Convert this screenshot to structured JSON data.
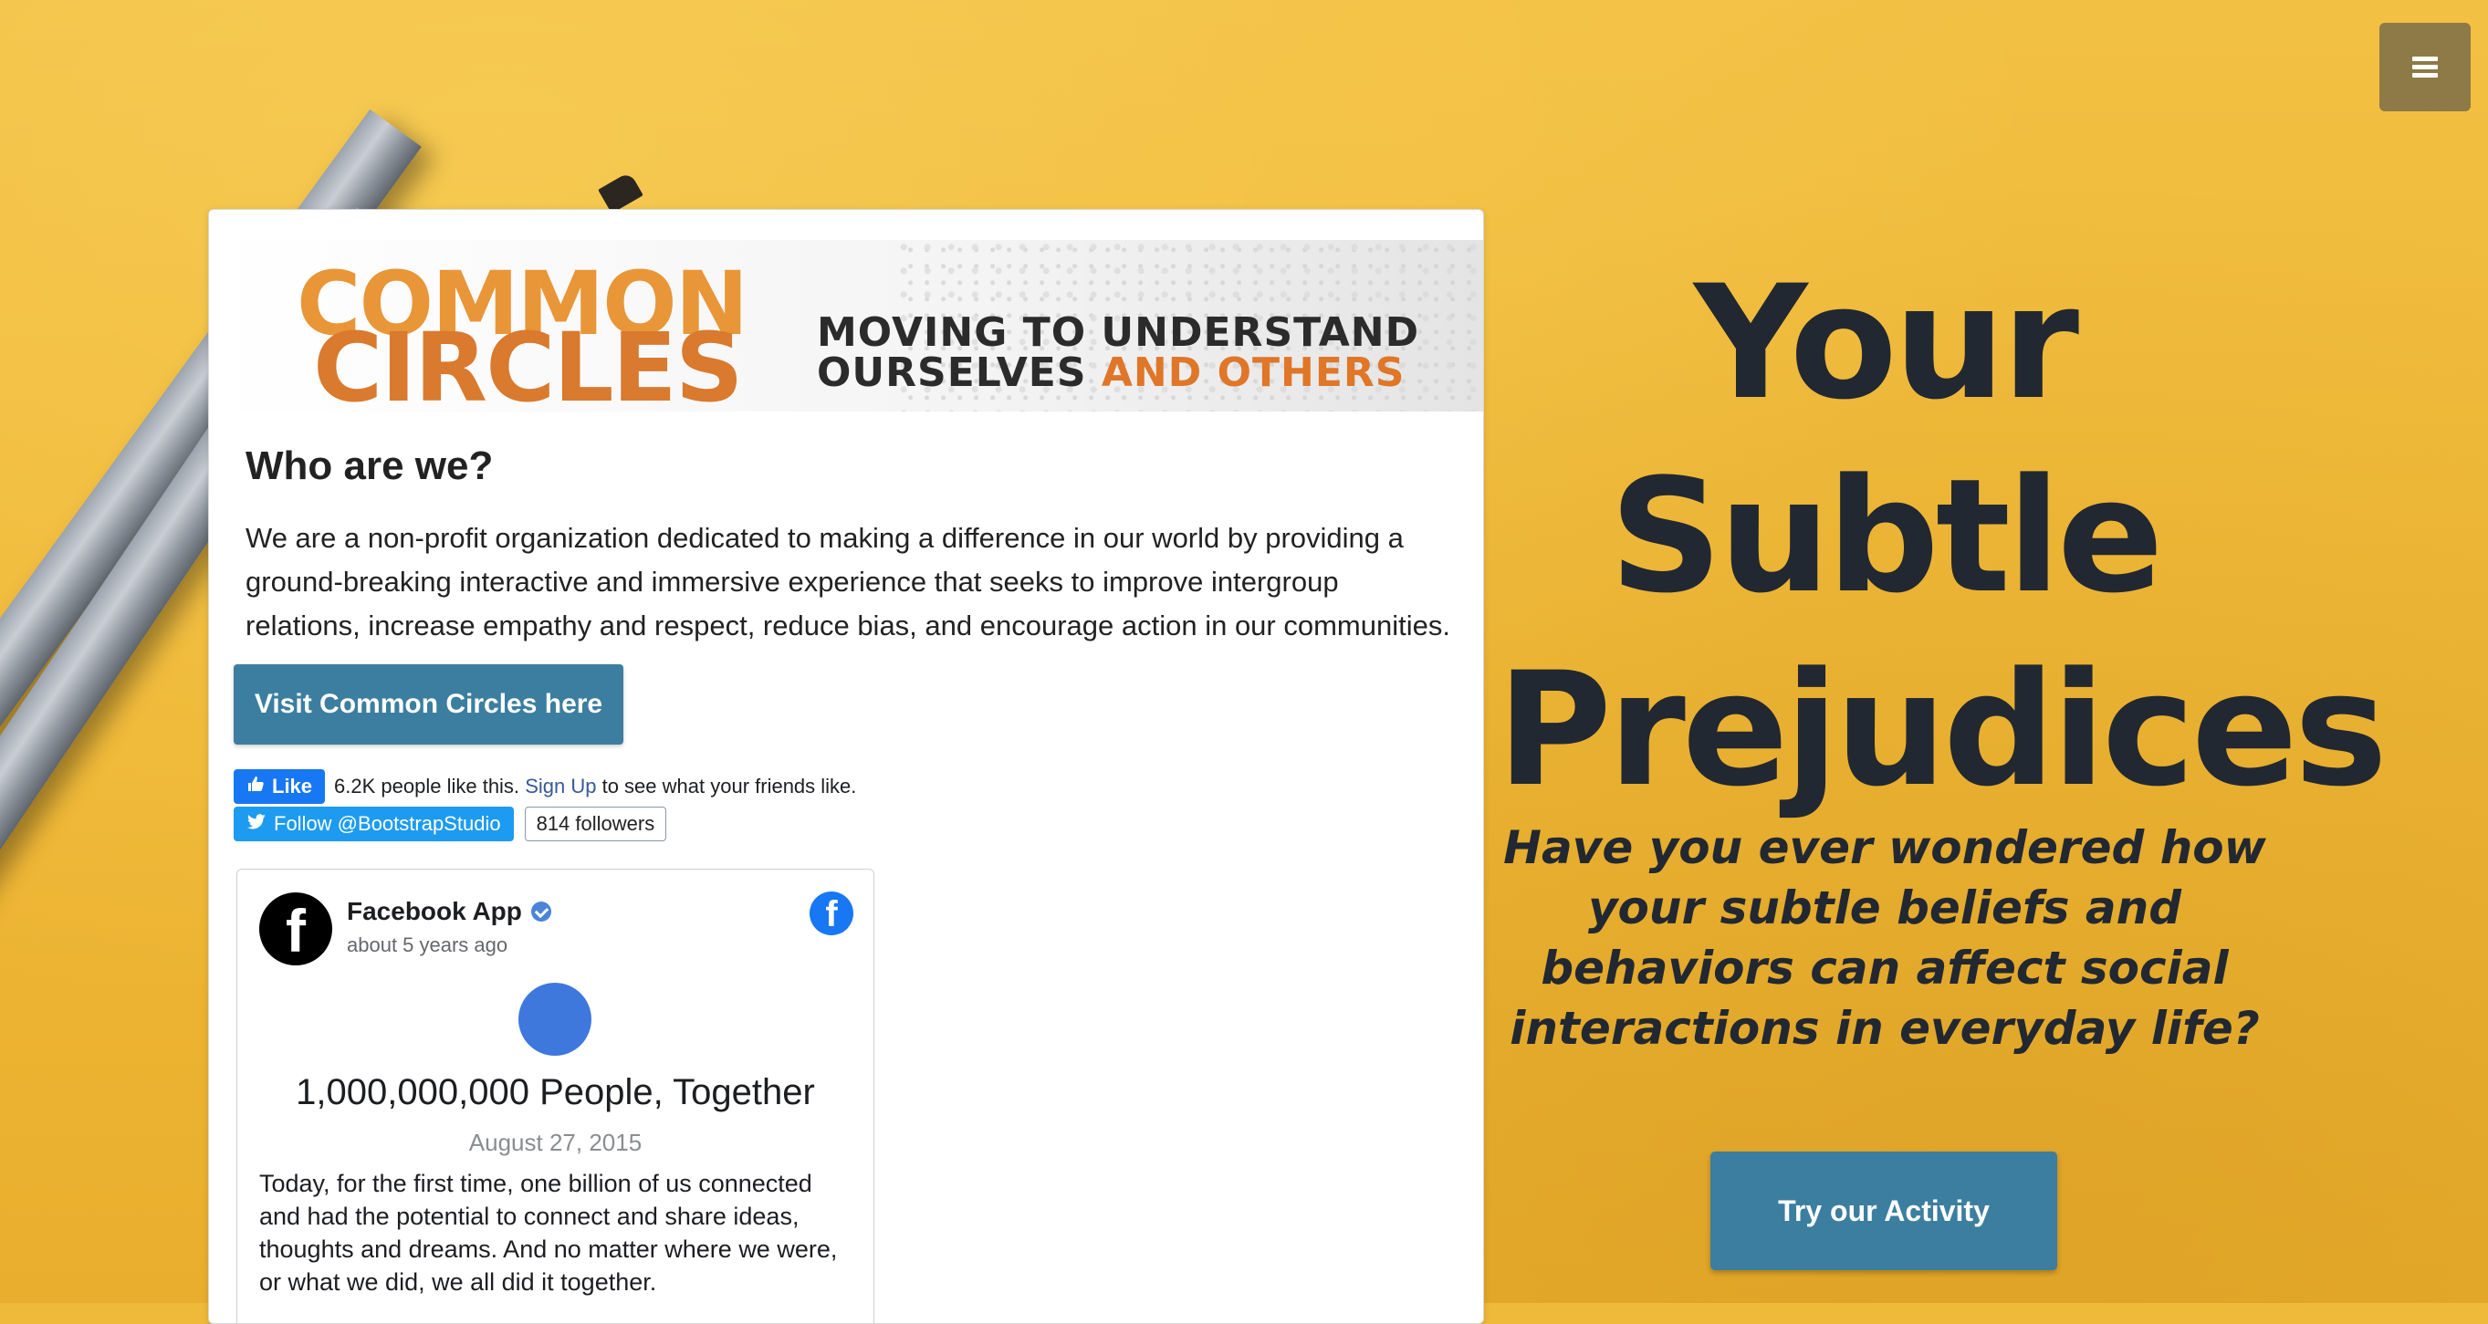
{
  "menu": {
    "icon": "hamburger-icon"
  },
  "banner": {
    "logo_line1": "COMMON",
    "logo_line2": "CIRCLES",
    "tagline_line1": "MOVING TO UNDERSTAND",
    "tagline_line2_a": "OURSELVES",
    "tagline_line2_b": "AND OTHERS"
  },
  "about": {
    "title": "Who are we?",
    "text": "We are a non-profit organization dedicated to making a difference in our world by providing a ground-breaking interactive and immersive experience that seeks to improve intergroup relations, increase empathy and respect, reduce bias, and encourage action in our communities.",
    "visit_button": "Visit Common Circles here"
  },
  "facebook_like": {
    "button_label": "Like",
    "count_text": "6.2K people like this.",
    "signup_link": "Sign Up",
    "suffix": "to see what your friends like."
  },
  "twitter_follow": {
    "button_label": "Follow @BootstrapStudio",
    "followers": "814 followers"
  },
  "facebook_post": {
    "author": "Facebook App",
    "time": "about 5 years ago",
    "headline": "1,000,000,000 People, Together",
    "date": "August 27, 2015",
    "body": "Today, for the first time, one billion of us connected and had the potential to connect and share ideas, thoughts and dreams. And no matter where we were, or what we did, we all did it together."
  },
  "hero": {
    "title_line1": "Your",
    "title_line2": "Subtle",
    "title_line3": "Prejudices",
    "subtitle": "Have you ever wondered how your subtle beliefs and behaviors can affect social interactions in everyday life?",
    "cta": "Try our Activity"
  },
  "colors": {
    "background": "#efb93a",
    "button": "#3c7ea0",
    "menu_button": "#8e7a46",
    "heading": "#222831",
    "logo_orange": "#e89638",
    "facebook_blue": "#1877f2",
    "twitter_blue": "#1d9bf0"
  }
}
